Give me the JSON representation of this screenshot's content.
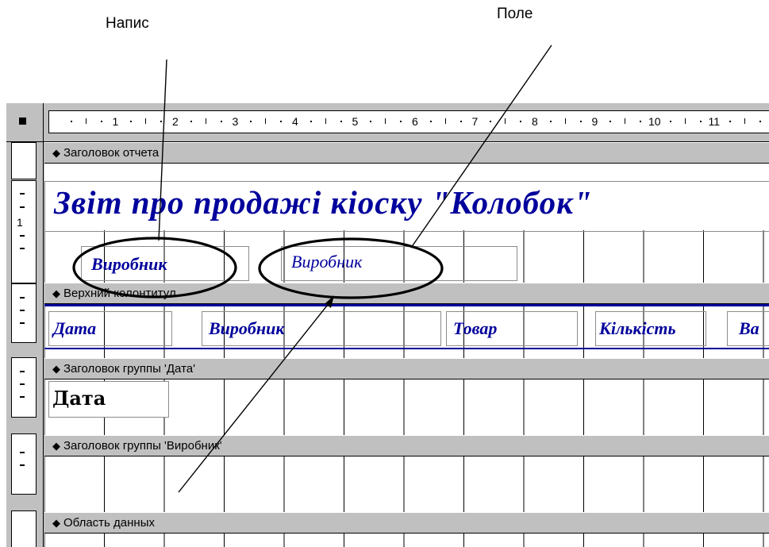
{
  "callouts": {
    "label": "Напис",
    "field": "Поле"
  },
  "ruler": {
    "numbers": [
      "1",
      "2",
      "3",
      "4",
      "5",
      "6",
      "7",
      "8",
      "9",
      "10",
      "11"
    ],
    "vertical_number": "1"
  },
  "sections": {
    "report_header": "Заголовок отчета",
    "page_header": "Верхний колонтитул",
    "group_header_date": "Заголовок группы 'Дата'",
    "group_header_producer": "Заголовок группы 'Виробник'",
    "detail": "Область данных"
  },
  "report_header": {
    "title": "Звіт про продажі кіоску \"Колобок\"",
    "producer_label": "Виробник",
    "producer_field": "Виробник"
  },
  "page_header": {
    "columns": [
      "Дата",
      "Виробник",
      "Товар",
      "Кількість",
      "Ва"
    ]
  },
  "group_date": {
    "field": "Дата"
  },
  "colors": {
    "label_text": "#00009c",
    "section_bar": "#c0c0c0",
    "page_header_line": "#00009c"
  }
}
